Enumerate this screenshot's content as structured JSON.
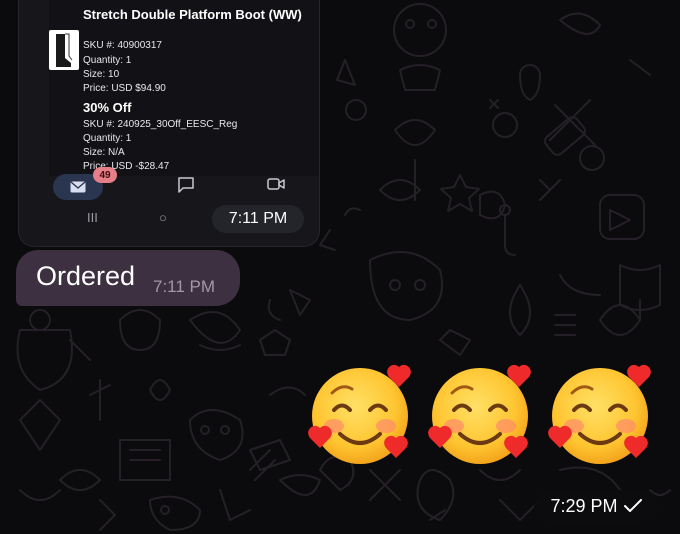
{
  "screenshot": {
    "product": {
      "name": "Stretch Double Platform Boot (WW)",
      "sku": "SKU #: 40900317",
      "quantity": "Quantity: 1",
      "size": "Size: 10",
      "price": "Price: USD $94.90"
    },
    "discount": {
      "name": "30% Off",
      "sku": "SKU #: 240925_30Off_EESC_Reg",
      "quantity": "Quantity: 1",
      "size": "Size: N/A",
      "price": "Price: USD -$28.47"
    },
    "mail_badge": "49",
    "sys_nav": {
      "recents": "III",
      "home": "○",
      "back": "<"
    },
    "time": "7:11 PM"
  },
  "message": {
    "text": "Ordered",
    "time": "7:11 PM"
  },
  "emoji": {
    "count": 3,
    "name": "smiling-face-with-hearts-icon"
  },
  "emoji_message": {
    "time": "7:29 PM",
    "status_icon": "single-check-icon"
  },
  "colors": {
    "bubble": "#3d3041",
    "background": "#0b0a0c",
    "badge": "#e57e86"
  }
}
